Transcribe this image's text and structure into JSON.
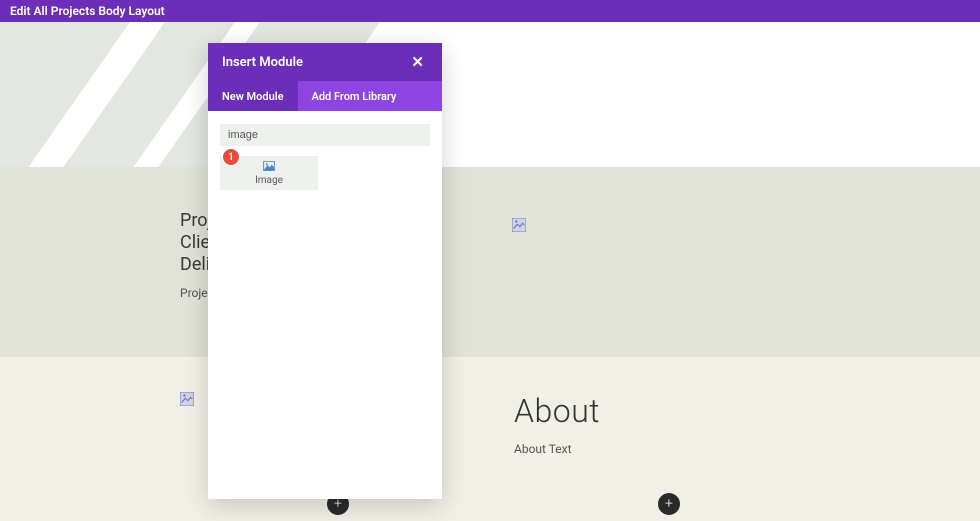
{
  "top_bar": {
    "title": "Edit All Projects Body Layout"
  },
  "modal": {
    "title": "Insert Module",
    "tabs": {
      "new_module": "New Module",
      "add_from_library": "Add From Library"
    },
    "search_value": "image",
    "modules": {
      "image": "Image"
    }
  },
  "step": {
    "number": "1"
  },
  "project_section": {
    "line_project": "Proje",
    "line_client": "Clier",
    "line_deliv": "Deliv",
    "description": "Projec"
  },
  "about_section": {
    "title": "About",
    "subtitle": "About Text"
  },
  "icons": {
    "plus": "+",
    "close": "✕"
  }
}
